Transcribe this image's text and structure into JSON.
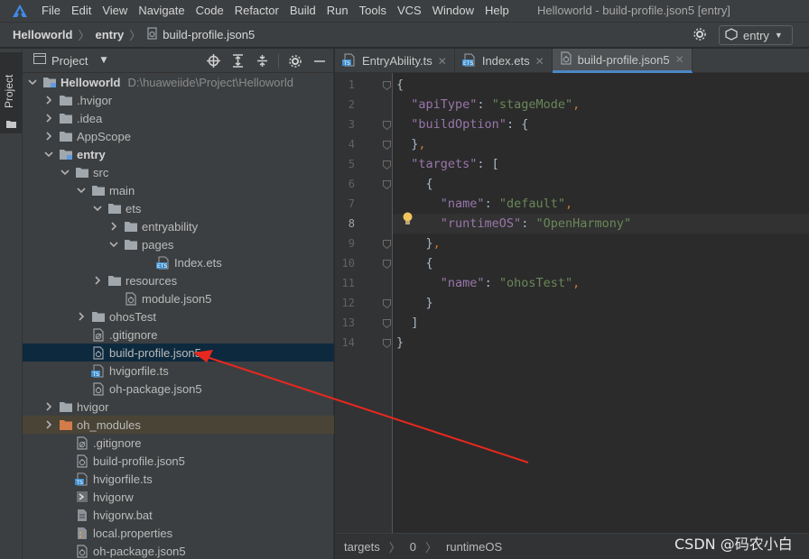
{
  "menubar": {
    "items": [
      "File",
      "Edit",
      "View",
      "Navigate",
      "Code",
      "Refactor",
      "Build",
      "Run",
      "Tools",
      "VCS",
      "Window",
      "Help"
    ],
    "window_title": "Helloworld - build-profile.json5 [entry]"
  },
  "navbar": {
    "crumbs": [
      "Helloworld",
      "entry",
      "build-profile.json5"
    ],
    "run_config": "entry"
  },
  "stripe": {
    "label": "Project"
  },
  "panel": {
    "title": "Project"
  },
  "tree": [
    {
      "label": "Helloworld",
      "path": "D:\\huaweiide\\Project\\Helloworld",
      "bold": true,
      "chevron": "down",
      "icon": "folder-module-icon",
      "depth": 0
    },
    {
      "label": ".hvigor",
      "chevron": "right",
      "icon": "folder-icon",
      "depth": 1
    },
    {
      "label": ".idea",
      "chevron": "right",
      "icon": "folder-icon",
      "depth": 1
    },
    {
      "label": "AppScope",
      "chevron": "right",
      "icon": "folder-icon",
      "depth": 1
    },
    {
      "label": "entry",
      "bold": true,
      "chevron": "down",
      "icon": "folder-module-icon",
      "depth": 1
    },
    {
      "label": "src",
      "chevron": "down",
      "icon": "folder-icon",
      "depth": 2
    },
    {
      "label": "main",
      "chevron": "down",
      "icon": "folder-icon",
      "depth": 3
    },
    {
      "label": "ets",
      "chevron": "down",
      "icon": "folder-icon",
      "depth": 4
    },
    {
      "label": "entryability",
      "chevron": "right",
      "icon": "folder-icon",
      "depth": 5
    },
    {
      "label": "pages",
      "chevron": "down",
      "icon": "folder-icon",
      "depth": 5
    },
    {
      "label": "Index.ets",
      "chevron": "none",
      "icon": "ets-file-icon",
      "depth": 7
    },
    {
      "label": "resources",
      "chevron": "right",
      "icon": "folder-icon",
      "depth": 4
    },
    {
      "label": "module.json5",
      "chevron": "none",
      "icon": "json-file-icon",
      "depth": 5
    },
    {
      "label": "ohosTest",
      "chevron": "right",
      "icon": "folder-icon",
      "depth": 3
    },
    {
      "label": ".gitignore",
      "chevron": "none",
      "icon": "gitignore-file-icon",
      "depth": 3
    },
    {
      "label": "build-profile.json5",
      "chevron": "none",
      "icon": "json-file-icon",
      "depth": 3,
      "selected": true
    },
    {
      "label": "hvigorfile.ts",
      "chevron": "none",
      "icon": "ts-file-icon",
      "depth": 3
    },
    {
      "label": "oh-package.json5",
      "chevron": "none",
      "icon": "json-file-icon",
      "depth": 3
    },
    {
      "label": "hvigor",
      "chevron": "right",
      "icon": "folder-icon",
      "depth": 1
    },
    {
      "label": "oh_modules",
      "chevron": "right",
      "icon": "folder-orange-icon",
      "depth": 1,
      "excluded": true
    },
    {
      "label": ".gitignore",
      "chevron": "none",
      "icon": "gitignore-file-icon",
      "depth": 2
    },
    {
      "label": "build-profile.json5",
      "chevron": "none",
      "icon": "json-file-icon",
      "depth": 2
    },
    {
      "label": "hvigorfile.ts",
      "chevron": "none",
      "icon": "ts-file-icon",
      "depth": 2
    },
    {
      "label": "hvigorw",
      "chevron": "none",
      "icon": "script-file-icon",
      "depth": 2
    },
    {
      "label": "hvigorw.bat",
      "chevron": "none",
      "icon": "text-file-icon",
      "depth": 2
    },
    {
      "label": "local.properties",
      "chevron": "none",
      "icon": "properties-file-icon",
      "depth": 2
    },
    {
      "label": "oh-package.json5",
      "chevron": "none",
      "icon": "json-file-icon",
      "depth": 2
    }
  ],
  "tabs": [
    {
      "label": "EntryAbility.ts",
      "icon": "ts-file-icon",
      "active": false
    },
    {
      "label": "Index.ets",
      "icon": "ets-file-icon",
      "active": false
    },
    {
      "label": "build-profile.json5",
      "icon": "json-file-icon",
      "active": true
    }
  ],
  "editor": {
    "line_numbers": [
      "1",
      "2",
      "3",
      "4",
      "5",
      "6",
      "7",
      "8",
      "9",
      "10",
      "11",
      "12",
      "13",
      "14"
    ],
    "current_line": 8,
    "code": [
      [
        {
          "t": "p",
          "v": "{"
        }
      ],
      [
        {
          "t": "p",
          "v": "  "
        },
        {
          "t": "k",
          "v": "\"apiType\""
        },
        {
          "t": "p",
          "v": ": "
        },
        {
          "t": "s",
          "v": "\"stageMode\""
        },
        {
          "t": "c",
          "v": ","
        }
      ],
      [
        {
          "t": "p",
          "v": "  "
        },
        {
          "t": "k",
          "v": "\"buildOption\""
        },
        {
          "t": "p",
          "v": ": {"
        }
      ],
      [
        {
          "t": "p",
          "v": "  }"
        },
        {
          "t": "c",
          "v": ","
        }
      ],
      [
        {
          "t": "p",
          "v": "  "
        },
        {
          "t": "k",
          "v": "\"targets\""
        },
        {
          "t": "p",
          "v": ": ["
        }
      ],
      [
        {
          "t": "p",
          "v": "    {"
        }
      ],
      [
        {
          "t": "p",
          "v": "      "
        },
        {
          "t": "k",
          "v": "\"name\""
        },
        {
          "t": "p",
          "v": ": "
        },
        {
          "t": "s",
          "v": "\"default\""
        },
        {
          "t": "c",
          "v": ","
        }
      ],
      [
        {
          "t": "p",
          "v": "      "
        },
        {
          "t": "k",
          "v": "\"runtimeOS\""
        },
        {
          "t": "p",
          "v": ": "
        },
        {
          "t": "s",
          "v": "\"OpenHarmony\""
        }
      ],
      [
        {
          "t": "p",
          "v": "    }"
        },
        {
          "t": "c",
          "v": ","
        }
      ],
      [
        {
          "t": "p",
          "v": "    {"
        }
      ],
      [
        {
          "t": "p",
          "v": "      "
        },
        {
          "t": "k",
          "v": "\"name\""
        },
        {
          "t": "p",
          "v": ": "
        },
        {
          "t": "s",
          "v": "\"ohosTest\""
        },
        {
          "t": "c",
          "v": ","
        }
      ],
      [
        {
          "t": "p",
          "v": "    }"
        }
      ],
      [
        {
          "t": "p",
          "v": "  ]"
        }
      ],
      [
        {
          "t": "p",
          "v": "}"
        }
      ]
    ]
  },
  "editor_breadcrumb": [
    "targets",
    "0",
    "runtimeOS"
  ],
  "watermark": "CSDN @码农小白",
  "colors": {
    "accent": "#4a88c7",
    "selection": "#0d293e",
    "arrow": "#e8281e"
  }
}
